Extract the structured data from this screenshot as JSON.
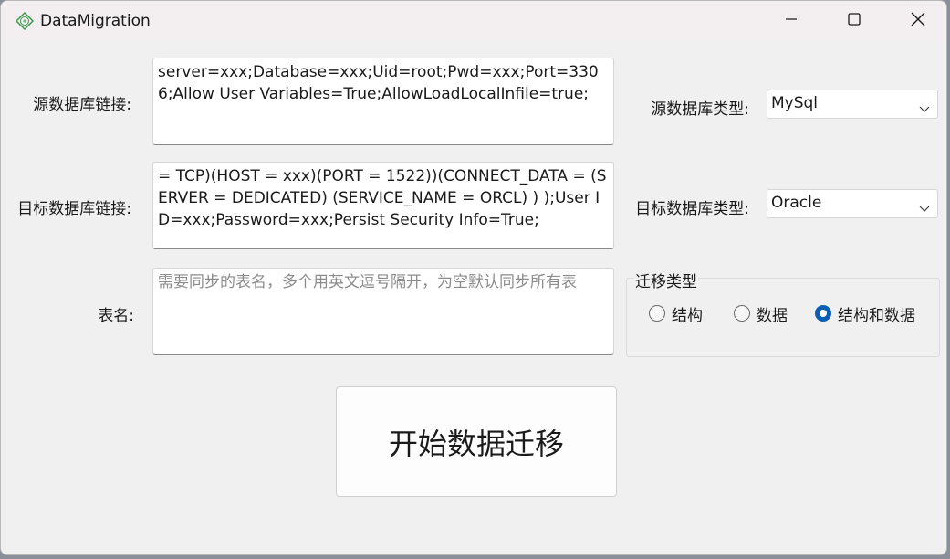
{
  "window": {
    "title": "DataMigration"
  },
  "form": {
    "source_conn_label": "源数据库链接:",
    "source_conn_value": "server=xxx;Database=xxx;Uid=root;Pwd=xxx;Port=3306;Allow User Variables=True;AllowLoadLocalInfile=true;",
    "target_conn_label": "目标数据库链接:",
    "target_conn_value": "= TCP)(HOST = xxx)(PORT = 1522))(CONNECT_DATA = (SERVER = DEDICATED) (SERVICE_NAME = ORCL) ) );User ID=xxx;Password=xxx;Persist Security Info=True;",
    "tables_label": "表名:",
    "tables_placeholder": "需要同步的表名，多个用英文逗号隔开，为空默认同步所有表",
    "source_type_label": "源数据库类型:",
    "source_type_value": "MySql",
    "target_type_label": "目标数据库类型:",
    "target_type_value": "Oracle"
  },
  "migration": {
    "group_title": "迁移类型",
    "options": [
      {
        "label": "结构",
        "checked": false
      },
      {
        "label": "数据",
        "checked": false
      },
      {
        "label": "结构和数据",
        "checked": true
      }
    ]
  },
  "actions": {
    "start_label": "开始数据迁移"
  },
  "colors": {
    "accent": "#0a5fb4",
    "window_bg": "#f0f0f0"
  },
  "icons": {
    "app": "app-logo-icon",
    "minimize": "minimize-icon",
    "maximize": "maximize-icon",
    "close": "close-icon",
    "dropdown": "chevron-down-icon"
  }
}
